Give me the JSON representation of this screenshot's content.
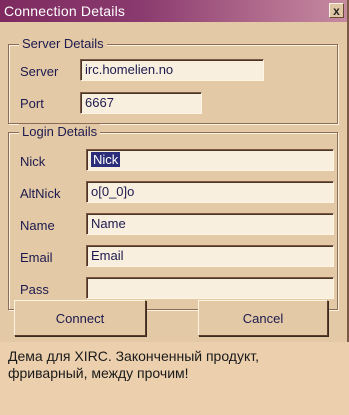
{
  "window": {
    "title": "Connection Details",
    "close_glyph": "x"
  },
  "server_group": {
    "label": "Server Details",
    "server_label": "Server",
    "server_value": "irc.homelien.no",
    "port_label": "Port",
    "port_value": "6667"
  },
  "login_group": {
    "label": "Login Details",
    "nick_label": "Nick",
    "nick_value": "Nick",
    "altnick_label": "AltNick",
    "altnick_value": "o[0_0]o",
    "name_label": "Name",
    "name_value": "Name",
    "email_label": "Email",
    "email_value": "Email",
    "pass_label": "Pass",
    "pass_value": ""
  },
  "buttons": {
    "connect": "Connect",
    "cancel": "Cancel"
  },
  "caption": "Дема для XIRC. Законченный продукт, фриварный, между прочим!"
}
